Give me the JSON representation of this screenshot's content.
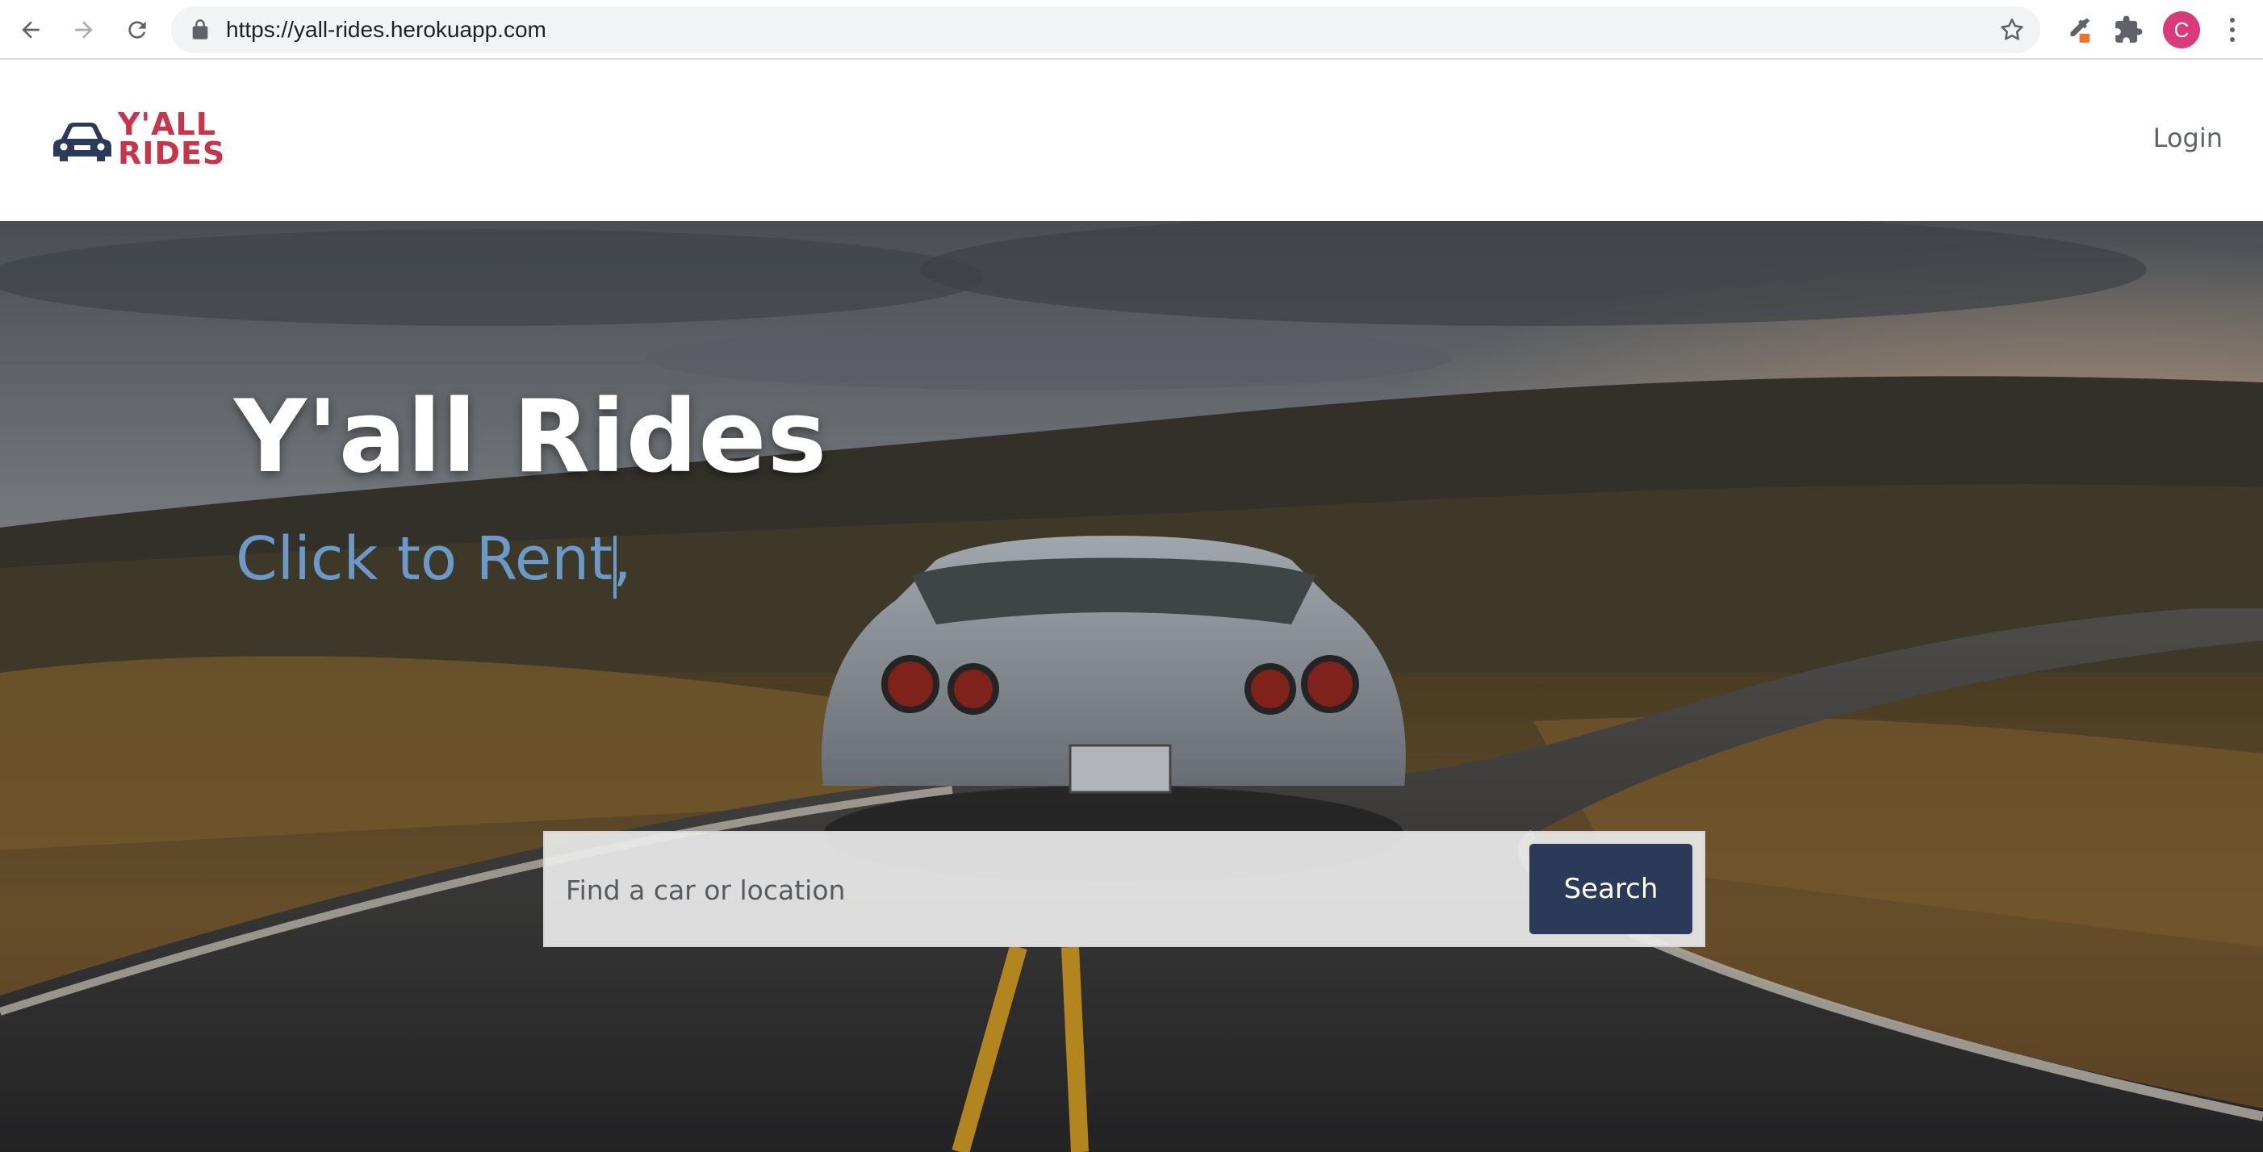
{
  "browser": {
    "url": "https://yall-rides.herokuapp.com",
    "profile_initial": "C",
    "icons": [
      "back-icon",
      "forward-icon",
      "reload-icon",
      "lock-icon",
      "bookmark-star-icon",
      "eyedropper-extension-icon",
      "extensions-puzzle-icon",
      "kebab-menu-icon"
    ]
  },
  "navbar": {
    "logo_line1": "Y'ALL",
    "logo_line2": "RIDES",
    "login_label": "Login"
  },
  "hero": {
    "title": "Y'all Rides",
    "tagline": "Click to Rent,",
    "search_placeholder": "Find a car or location",
    "search_button_label": "Search"
  },
  "colors": {
    "brand_red": "#c9344a",
    "navy": "#2b3a58",
    "tagline_blue": "#6b9ac9",
    "avatar_pink": "#d93a7a"
  }
}
